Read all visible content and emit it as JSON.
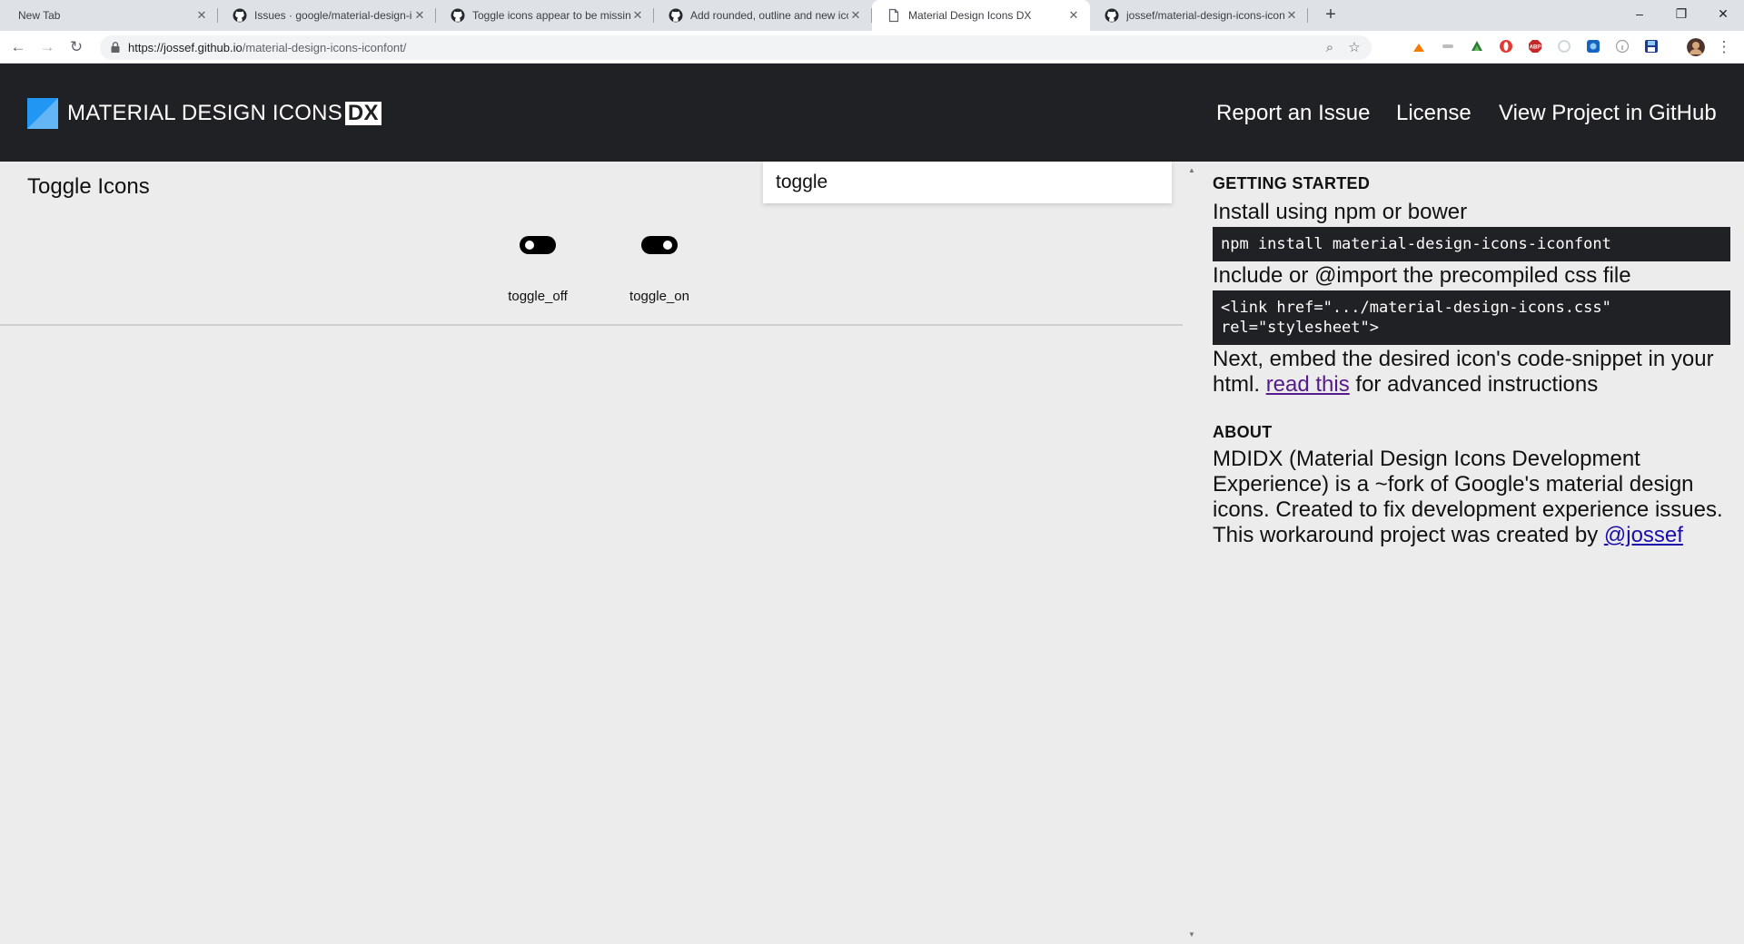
{
  "browser": {
    "tabs": [
      {
        "title": "New Tab",
        "favicon": "none"
      },
      {
        "title": "Issues · google/material-design-icons",
        "favicon": "github-icon"
      },
      {
        "title": "Toggle icons appear to be missing",
        "favicon": "github-icon"
      },
      {
        "title": "Add rounded, outline and new icons",
        "favicon": "github-icon"
      },
      {
        "title": "Material Design Icons DX",
        "favicon": "page-icon",
        "active": true
      },
      {
        "title": "jossef/material-design-icons-iconfont",
        "favicon": "github-icon"
      }
    ],
    "new_tab_symbol": "+",
    "window_controls": {
      "minimize": "–",
      "restore": "❐",
      "close": "✕"
    },
    "url": {
      "host": "https://jossef.github.io",
      "path": "/material-design-icons-iconfont/"
    },
    "nav_symbols": {
      "back": "←",
      "forward": "→",
      "reload": "↻",
      "zoom": "⌕",
      "bookmark": "☆",
      "menu": "⋮"
    },
    "tab_close_symbol": "✕",
    "accent_colors": {
      "tab_bar": "#dee1e6",
      "omnibox": "#f1f3f4"
    }
  },
  "site": {
    "brand": "MATERIAL DESIGN ICONS",
    "brand_badge": "DX",
    "nav": [
      "Report an Issue",
      "License",
      "View Project in GitHub"
    ],
    "header_color": "#202124",
    "logo_colors": [
      "#2196f3",
      "#64b5f6"
    ]
  },
  "search": {
    "value": "toggle"
  },
  "results": {
    "section_title": "Toggle Icons",
    "icons": [
      {
        "label": "toggle_off",
        "icon": "toggle-off-icon"
      },
      {
        "label": "toggle_on",
        "icon": "toggle-on-icon"
      }
    ]
  },
  "scroll": {
    "up": "▲",
    "down": "▼"
  },
  "sidebar": {
    "getting_started": {
      "heading": "GETTING STARTED",
      "install_text": "Install using npm or bower",
      "install_code": "npm install material-design-icons-iconfont",
      "include_text": "Include or @import the precompiled css file",
      "include_code": "<link href=\".../material-design-icons.css\"\nrel=\"stylesheet\">",
      "embed_text_before": "Next, embed the desired icon's code-snippet in your html. ",
      "embed_link": "read this",
      "embed_text_after": " for advanced instructions"
    },
    "about": {
      "heading": "ABOUT",
      "text": "MDIDX (Material Design Icons Development Experience) is a ~fork of Google's material design icons. Created to fix development experience issues. This workaround project was created by ",
      "link": "@jossef"
    }
  }
}
